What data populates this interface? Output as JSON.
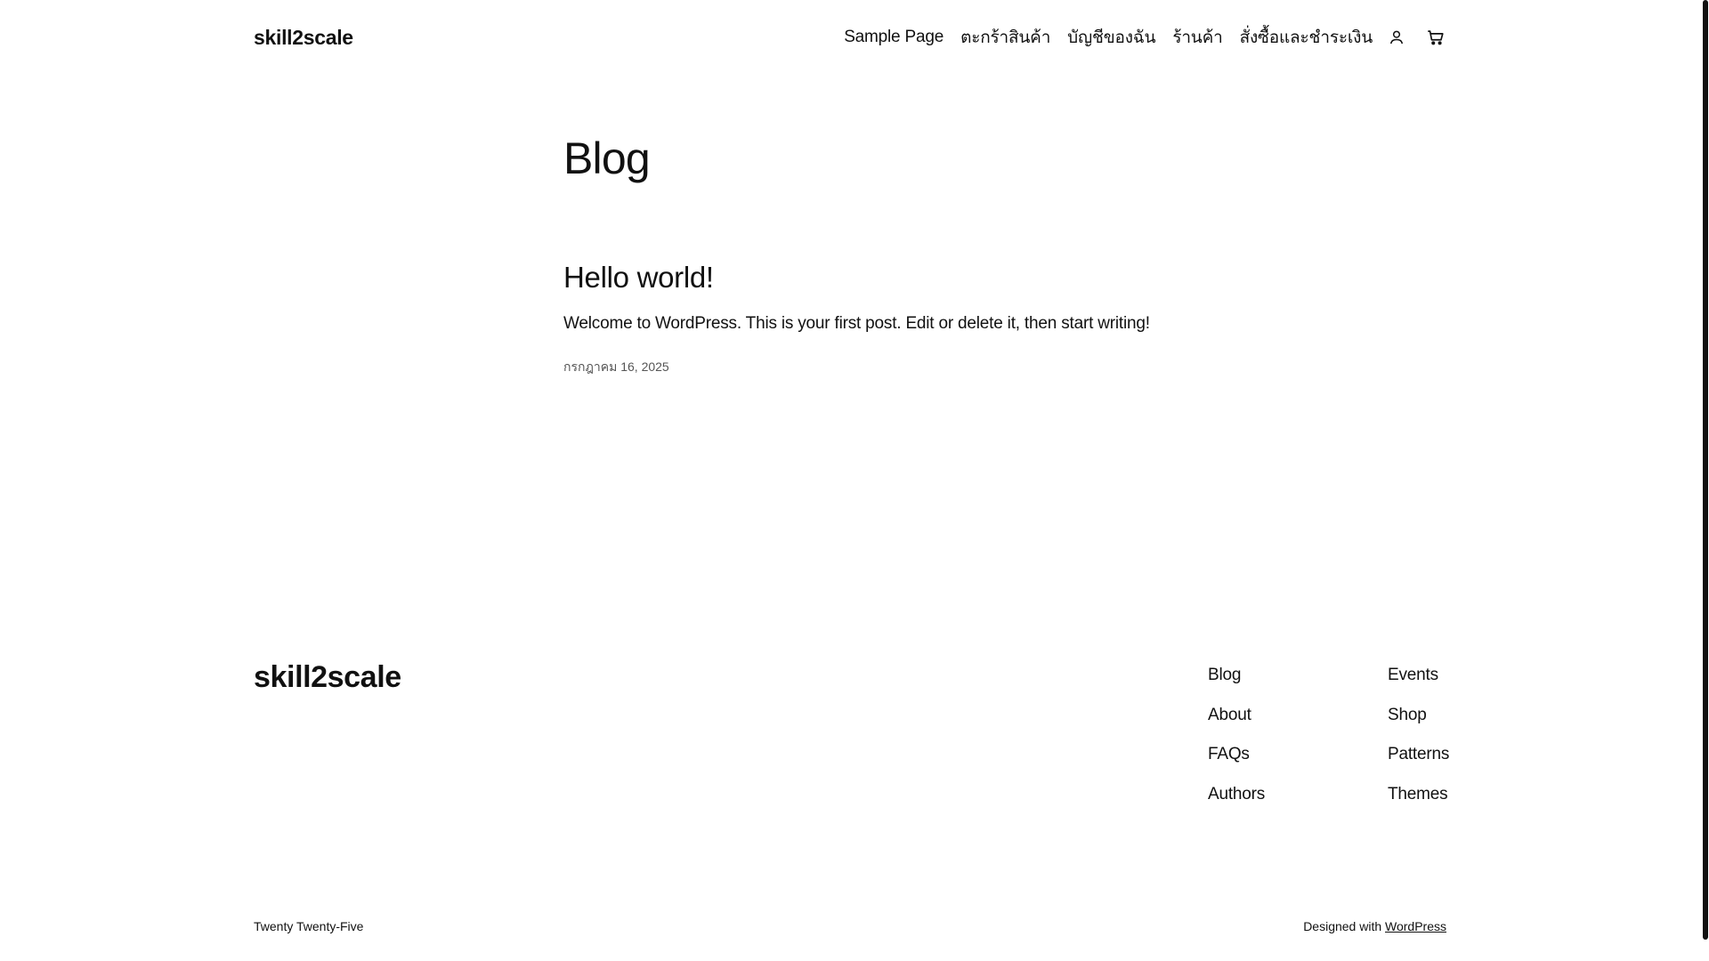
{
  "header": {
    "site_title": "skill2scale",
    "nav": [
      {
        "label": "Sample Page"
      },
      {
        "label": "ตะกร้าสินค้า"
      },
      {
        "label": "บัญชีของฉัน"
      },
      {
        "label": "ร้านค้า"
      },
      {
        "label": "สั่งซื้อและชำระเงิน"
      }
    ],
    "icons": {
      "account": "user-icon",
      "cart": "cart-icon"
    }
  },
  "main": {
    "page_title": "Blog",
    "posts": [
      {
        "title": "Hello world!",
        "excerpt": "Welcome to WordPress. This is your first post. Edit or delete it, then start writing!",
        "date": "กรกฎาคม 16, 2025"
      }
    ]
  },
  "footer": {
    "site_title": "skill2scale",
    "columns": [
      [
        "Blog",
        "About",
        "FAQs",
        "Authors"
      ],
      [
        "Events",
        "Shop",
        "Patterns",
        "Themes"
      ]
    ],
    "theme_name": "Twenty Twenty-Five",
    "credit_prefix": "Designed with ",
    "credit_link": "WordPress"
  },
  "colors": {
    "text": "#111111",
    "background": "#ffffff",
    "muted": "#555555"
  }
}
